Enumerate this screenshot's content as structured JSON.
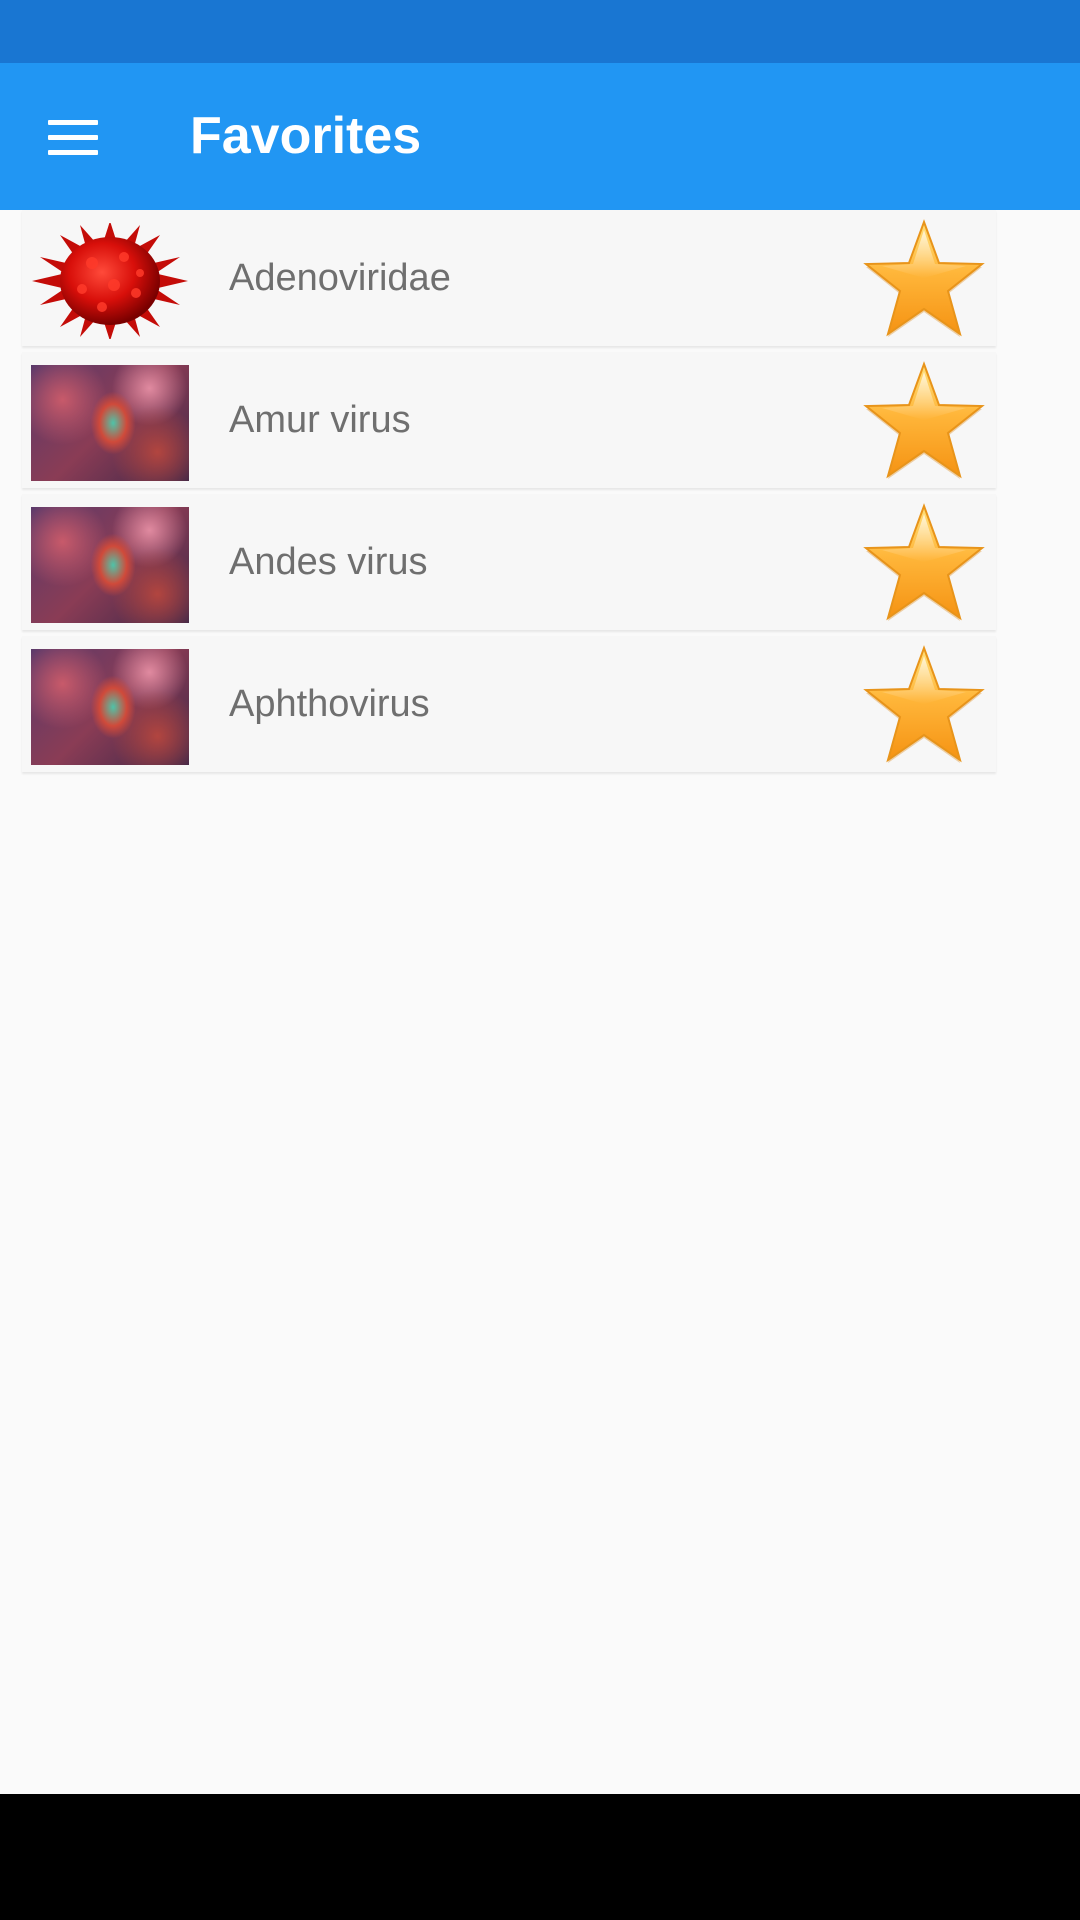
{
  "app_bar": {
    "title": "Favorites",
    "menu_icon": "hamburger-menu-icon"
  },
  "favorites": [
    {
      "name": "Adenoviridae",
      "thumbnail": "red-spiked-virus-icon",
      "favorited": true
    },
    {
      "name": "Amur virus",
      "thumbnail": "virus-photo",
      "favorited": true
    },
    {
      "name": "Andes virus",
      "thumbnail": "virus-photo",
      "favorited": true
    },
    {
      "name": "Aphthovirus",
      "thumbnail": "virus-photo",
      "favorited": true
    }
  ],
  "colors": {
    "status_bar": "#1976d2",
    "app_bar": "#2196f3",
    "background": "#fafafa",
    "item_text": "#6f6f6f",
    "star": "#f7a823",
    "nav_bar": "#000000"
  }
}
